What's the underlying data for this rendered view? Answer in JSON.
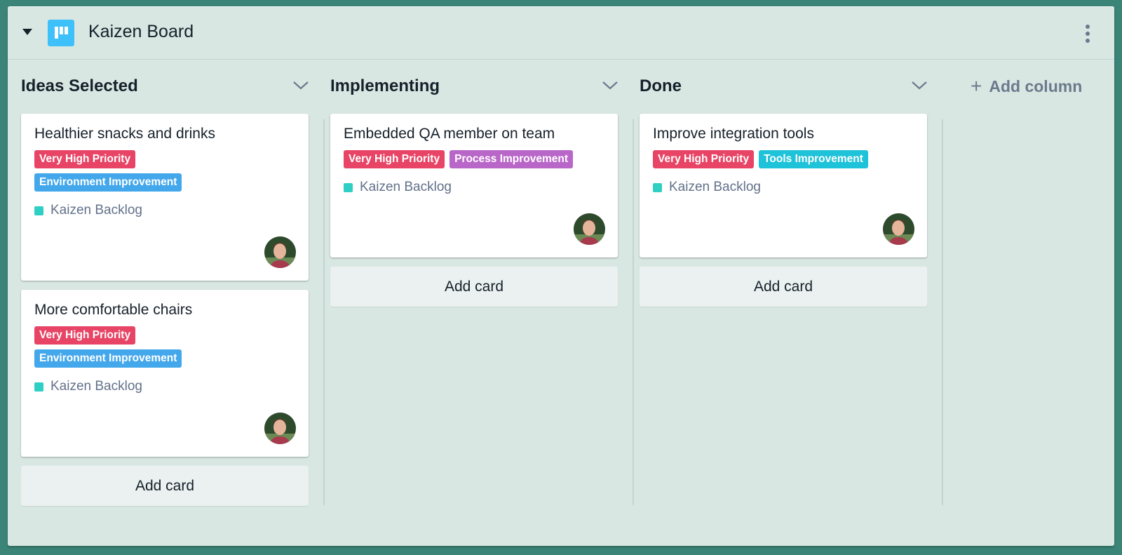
{
  "header": {
    "title": "Kaizen Board",
    "icon": "board-kanban-icon",
    "collapse_icon": "caret-down-icon",
    "menu_icon": "more-vertical-icon"
  },
  "colors": {
    "background": "#3a8577",
    "board_bg": "#d9e7e3",
    "icon_accent": "#3ec1fa",
    "priority_label": "#e84465",
    "environment_label": "#43a7eb",
    "process_label": "#b966c9",
    "tools_label": "#1ec2d9",
    "backlog_square": "#2fcfc3"
  },
  "add_column_label": "Add column",
  "columns": [
    {
      "title": "Ideas Selected",
      "add_card_label": "Add card",
      "cards": [
        {
          "title": "Healthier snacks and drinks",
          "labels": [
            {
              "text": "Very High Priority",
              "color": "#e84465"
            },
            {
              "text": "Environment Improvement",
              "color": "#43a7eb"
            }
          ],
          "board": "Kaizen Backlog"
        },
        {
          "title": "More comfortable chairs",
          "labels": [
            {
              "text": "Very High Priority",
              "color": "#e84465"
            },
            {
              "text": "Environment Improvement",
              "color": "#43a7eb"
            }
          ],
          "board": "Kaizen Backlog"
        }
      ]
    },
    {
      "title": "Implementing",
      "add_card_label": "Add card",
      "cards": [
        {
          "title": "Embedded QA member on team",
          "labels": [
            {
              "text": "Very High Priority",
              "color": "#e84465"
            },
            {
              "text": "Process Improvement",
              "color": "#b966c9"
            }
          ],
          "board": "Kaizen Backlog"
        }
      ]
    },
    {
      "title": "Done",
      "add_card_label": "Add card",
      "cards": [
        {
          "title": "Improve integration tools",
          "labels": [
            {
              "text": "Very High Priority",
              "color": "#e84465"
            },
            {
              "text": "Tools Improvement",
              "color": "#1ec2d9"
            }
          ],
          "board": "Kaizen Backlog"
        }
      ]
    }
  ]
}
